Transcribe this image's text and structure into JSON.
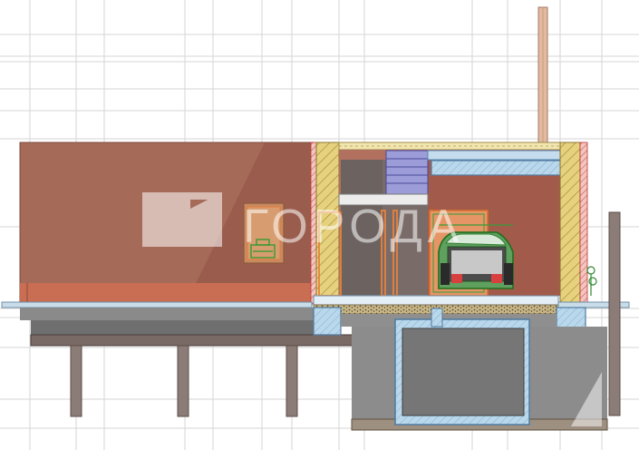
{
  "watermark": {
    "text": "ГОРОДА"
  },
  "colors": {
    "grid_line": "#d4d4d4",
    "facade_brown": "#a86a58",
    "facade_shadow": "#9a5c4c",
    "lower_band": "#c96a4e",
    "insulation_hatch": "#e4cf7a",
    "slab_blue": "#a9cfe6",
    "foundation_gray": "#6f6f6f",
    "pile_gray": "#8a7a76",
    "chimney": "#e0b79f",
    "orange_frame": "#e8823c",
    "car_green": "#2f8f2f",
    "watermark_white": "#ffffff"
  },
  "icons": {
    "car": "car-symbol",
    "stove": "stove-symbol",
    "logo": "city-logo-mark"
  }
}
